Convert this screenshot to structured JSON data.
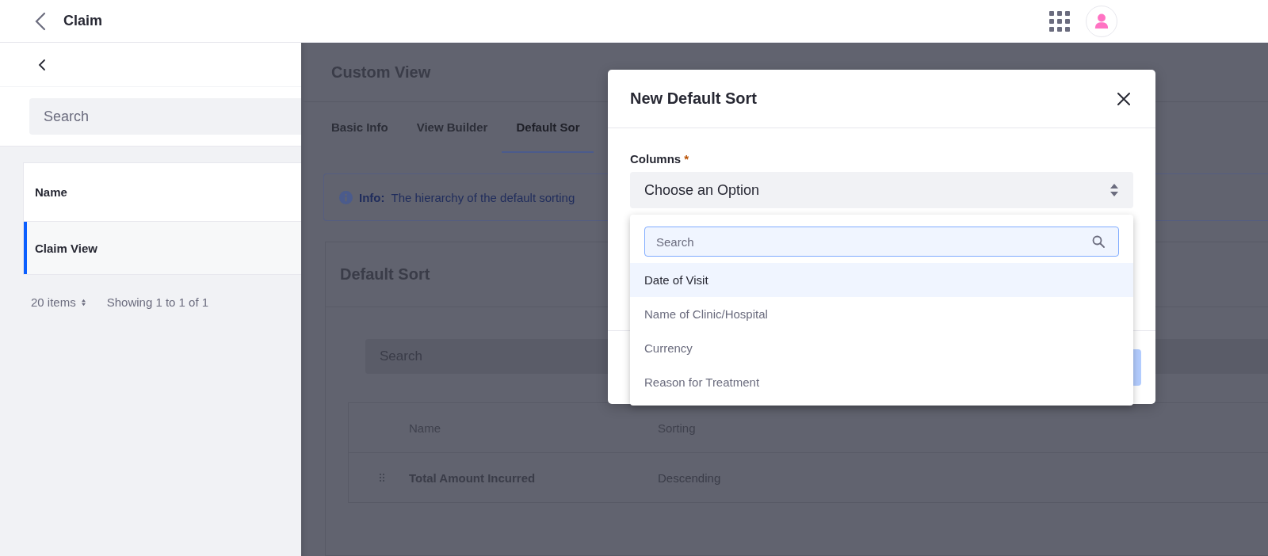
{
  "top_bar": {
    "title": "Claim"
  },
  "sidebar": {
    "search": {
      "placeholder": "Search"
    },
    "table": {
      "column": "Name",
      "rows": [
        {
          "name": "Claim View",
          "selected": true
        }
      ]
    },
    "pagination": {
      "page_size": "20 items",
      "summary": "Showing 1 to 1 of 1"
    }
  },
  "custom_view": {
    "title": "Custom View",
    "tabs": [
      {
        "label": "Basic Info",
        "selected": false
      },
      {
        "label": "View Builder",
        "selected": false
      },
      {
        "label": "Default Sor",
        "selected": true
      }
    ],
    "info": {
      "label": "Info:",
      "text": "The hierarchy of the default sorting"
    },
    "card": {
      "title": "Default Sort",
      "search": {
        "placeholder": "Search"
      },
      "columns": [
        "Name",
        "Sorting"
      ],
      "rows": [
        {
          "name": "Total Amount Incurred",
          "sorting": "Descending"
        }
      ]
    }
  },
  "modal": {
    "title": "New Default Sort",
    "field": {
      "label": "Columns",
      "required_mark": "*",
      "value": "Choose an Option"
    },
    "dropdown": {
      "search": {
        "placeholder": "Search"
      },
      "options": [
        {
          "label": "Date of Visit",
          "selected": true
        },
        {
          "label": "Name of Clinic/Hospital",
          "selected": false
        },
        {
          "label": "Currency",
          "selected": false
        },
        {
          "label": "Reason for Treatment",
          "selected": false
        }
      ]
    }
  }
}
